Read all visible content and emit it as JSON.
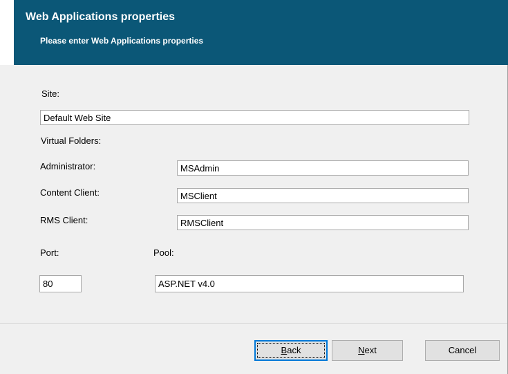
{
  "header": {
    "title": "Web Applications properties",
    "subtitle": "Please enter Web Applications properties"
  },
  "form": {
    "site": {
      "label": "Site:",
      "value": "Default Web Site"
    },
    "virtual_folders_label": "Virtual Folders:",
    "administrator": {
      "label": "Administrator:",
      "value": "MSAdmin"
    },
    "content_client": {
      "label": "Content Client:",
      "value": "MSClient"
    },
    "rms_client": {
      "label": "RMS Client:",
      "value": "RMSClient"
    },
    "port": {
      "label": "Port:",
      "value": "80"
    },
    "pool": {
      "label": "Pool:",
      "value": "ASP.NET v4.0"
    }
  },
  "buttons": {
    "back": {
      "mnemonic": "B",
      "rest": "ack"
    },
    "next": {
      "mnemonic": "N",
      "rest": "ext"
    },
    "cancel": "Cancel"
  },
  "colors": {
    "header_background": "#0b5777",
    "dialog_background": "#f0f0f0",
    "default_button_border": "#0078d7"
  }
}
